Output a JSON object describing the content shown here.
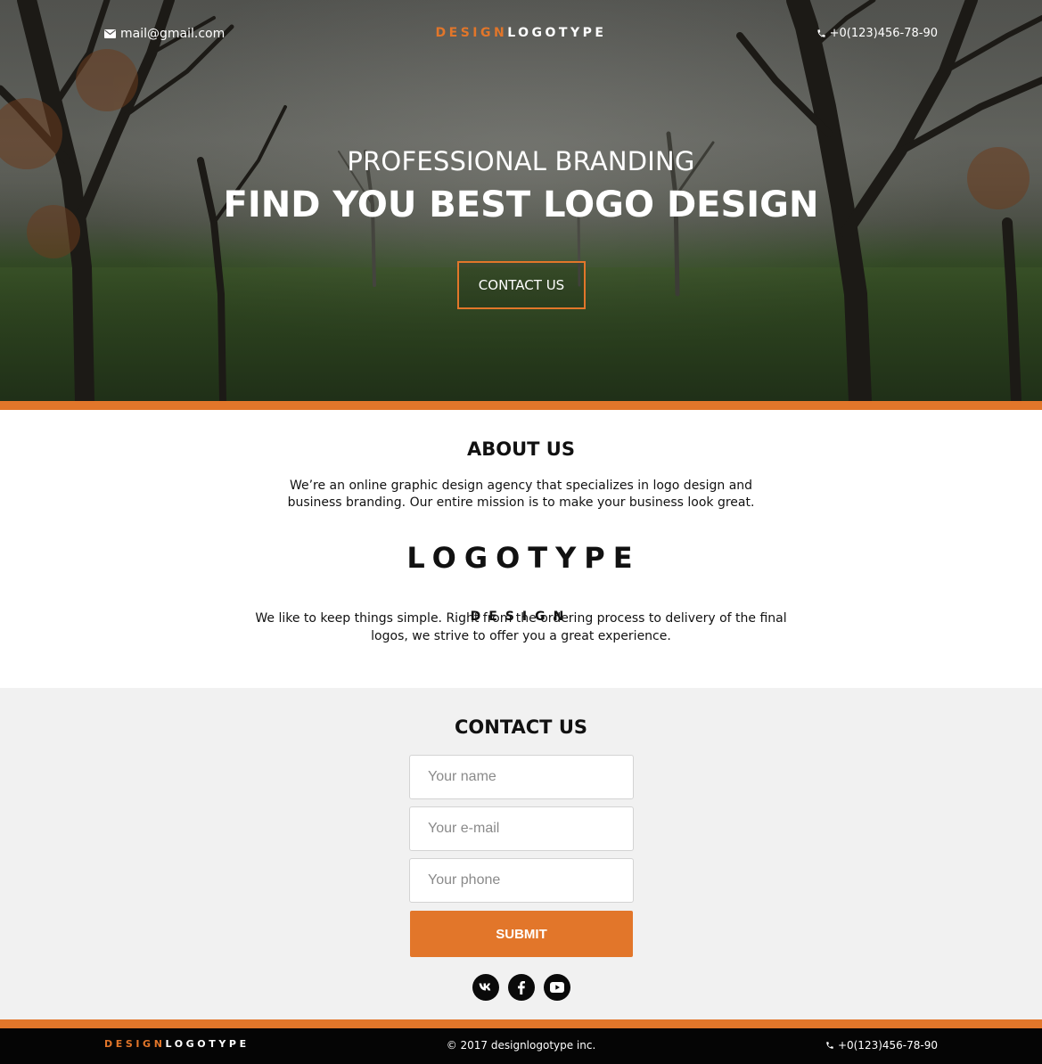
{
  "header": {
    "email": "mail@gmail.com",
    "logo_part1": "DESIGN",
    "logo_part2": "LOGOTYPE",
    "phone": "+0(123)456-78-90"
  },
  "hero": {
    "subtitle": "PROFESSIONAL BRANDING",
    "title": "FIND YOU BEST LOGO DESIGN",
    "button_label": "CONTACT US"
  },
  "about": {
    "heading": "ABOUT US",
    "paragraph1": "We’re an online graphic design agency that specializes in logo design and business branding. Our entire mission is to make your business look great.",
    "logo_part1": "DESIGN",
    "logo_part2": "LOGOTYPE",
    "paragraph2": "We like to keep things simple. Right from the ordering process to delivery of the final logos, we strive to offer you a great experience."
  },
  "contact": {
    "heading": "CONTACT US",
    "name_placeholder": "Your name",
    "email_placeholder": "Your e-mail",
    "phone_placeholder": "Your phone",
    "submit_label": "SUBMIT",
    "socials": [
      "vk-icon",
      "facebook-icon",
      "youtube-icon"
    ]
  },
  "footer": {
    "logo_part1": "DESIGN",
    "logo_part2": "LOGOTYPE",
    "copyright": "© 2017 designlogotype inc.",
    "phone": "+0(123)456-78-90"
  },
  "colors": {
    "accent": "#e2762a",
    "footer_bg": "#050505",
    "contact_bg": "#f1f1f1"
  }
}
